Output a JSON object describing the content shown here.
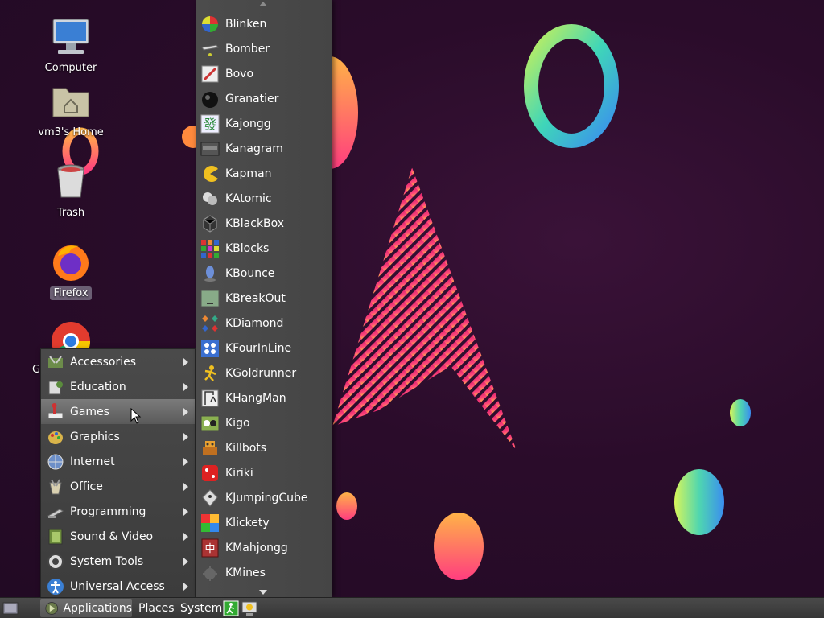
{
  "desktop": {
    "icons": [
      {
        "label": "Computer",
        "icon": "computer-icon"
      },
      {
        "label": "vm3's Home",
        "icon": "home-folder-icon"
      },
      {
        "label": "Trash",
        "icon": "trash-icon"
      },
      {
        "label": "Firefox",
        "icon": "firefox-icon"
      },
      {
        "label": "G",
        "icon": "chrome-icon"
      }
    ]
  },
  "apps_menu": {
    "items": [
      {
        "label": "Accessories",
        "icon": "accessories-icon"
      },
      {
        "label": "Education",
        "icon": "education-icon"
      },
      {
        "label": "Games",
        "icon": "games-icon",
        "active": true
      },
      {
        "label": "Graphics",
        "icon": "graphics-icon"
      },
      {
        "label": "Internet",
        "icon": "internet-icon"
      },
      {
        "label": "Office",
        "icon": "office-icon"
      },
      {
        "label": "Programming",
        "icon": "programming-icon"
      },
      {
        "label": "Sound & Video",
        "icon": "sound-video-icon"
      },
      {
        "label": "System Tools",
        "icon": "system-tools-icon"
      },
      {
        "label": "Universal Access",
        "icon": "universal-access-icon"
      }
    ]
  },
  "games_menu": {
    "items": [
      {
        "label": "Blinken"
      },
      {
        "label": "Bomber"
      },
      {
        "label": "Bovo"
      },
      {
        "label": "Granatier"
      },
      {
        "label": "Kajongg"
      },
      {
        "label": "Kanagram"
      },
      {
        "label": "Kapman"
      },
      {
        "label": "KAtomic"
      },
      {
        "label": "KBlackBox"
      },
      {
        "label": "KBlocks"
      },
      {
        "label": "KBounce"
      },
      {
        "label": "KBreakOut"
      },
      {
        "label": "KDiamond"
      },
      {
        "label": "KFourInLine"
      },
      {
        "label": "KGoldrunner"
      },
      {
        "label": "KHangMan"
      },
      {
        "label": "Kigo"
      },
      {
        "label": "Killbots"
      },
      {
        "label": "Kiriki"
      },
      {
        "label": "KJumpingCube"
      },
      {
        "label": "Klickety"
      },
      {
        "label": "KMahjongg"
      },
      {
        "label": "KMines"
      }
    ]
  },
  "taskbar": {
    "applications": "Applications",
    "places": "Places",
    "system": "System"
  },
  "colors": {
    "menu_bg": "#444444",
    "highlight": "#6a6a6a",
    "desktop_bg": "#2a0c2a"
  }
}
